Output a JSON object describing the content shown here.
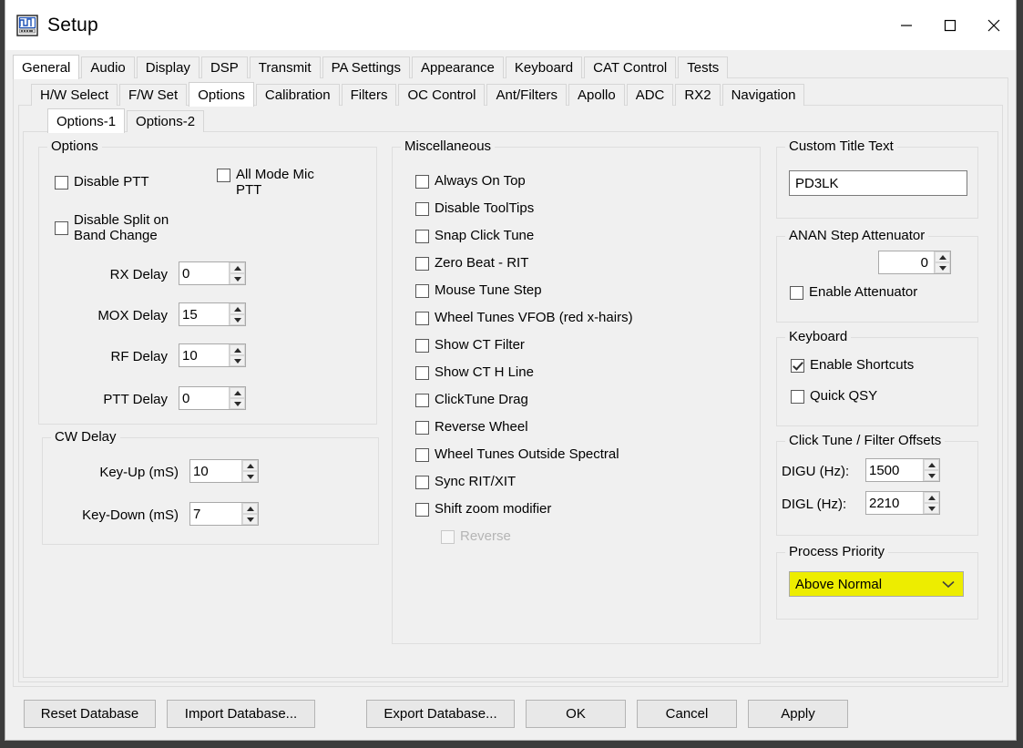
{
  "window": {
    "title": "Setup",
    "icon": "radio-setup-icon",
    "minimize": "minimize-icon",
    "maximize": "maximize-icon",
    "close": "close-icon"
  },
  "tabs_level1": [
    {
      "label": "General",
      "active": true
    },
    {
      "label": "Audio",
      "active": false
    },
    {
      "label": "Display",
      "active": false
    },
    {
      "label": "DSP",
      "active": false
    },
    {
      "label": "Transmit",
      "active": false
    },
    {
      "label": "PA Settings",
      "active": false
    },
    {
      "label": "Appearance",
      "active": false
    },
    {
      "label": "Keyboard",
      "active": false
    },
    {
      "label": "CAT Control",
      "active": false
    },
    {
      "label": "Tests",
      "active": false
    }
  ],
  "tabs_level2": [
    {
      "label": "H/W Select",
      "active": false
    },
    {
      "label": "F/W Set",
      "active": false
    },
    {
      "label": "Options",
      "active": true
    },
    {
      "label": "Calibration",
      "active": false
    },
    {
      "label": "Filters",
      "active": false
    },
    {
      "label": "OC Control",
      "active": false
    },
    {
      "label": "Ant/Filters",
      "active": false
    },
    {
      "label": "Apollo",
      "active": false
    },
    {
      "label": "ADC",
      "active": false
    },
    {
      "label": "RX2",
      "active": false
    },
    {
      "label": "Navigation",
      "active": false
    }
  ],
  "tabs_level3": [
    {
      "label": "Options-1",
      "active": true
    },
    {
      "label": "Options-2",
      "active": false
    }
  ],
  "options_group": {
    "title": "Options",
    "checkboxes": [
      {
        "label": "Disable PTT",
        "checked": false,
        "disabled": false
      },
      {
        "label": "All Mode Mic\nPTT",
        "checked": false,
        "disabled": false
      },
      {
        "label": "Disable Split on\nBand Change",
        "checked": false,
        "disabled": false
      }
    ],
    "spinners": [
      {
        "label": "RX Delay",
        "value": "0"
      },
      {
        "label": "MOX Delay",
        "value": "15"
      },
      {
        "label": "RF Delay",
        "value": "10"
      },
      {
        "label": "PTT Delay",
        "value": "0"
      }
    ]
  },
  "cw_delay_group": {
    "title": "CW Delay",
    "spinners": [
      {
        "label": "Key-Up (mS)",
        "value": "10"
      },
      {
        "label": "Key-Down (mS)",
        "value": "7"
      }
    ]
  },
  "misc_group": {
    "title": "Miscellaneous",
    "checkboxes": [
      {
        "label": "Always On Top",
        "checked": false,
        "disabled": false
      },
      {
        "label": "Disable ToolTips",
        "checked": false,
        "disabled": false
      },
      {
        "label": "Snap Click Tune",
        "checked": false,
        "disabled": false
      },
      {
        "label": "Zero Beat -  RIT",
        "checked": false,
        "disabled": false
      },
      {
        "label": "Mouse Tune Step",
        "checked": false,
        "disabled": false
      },
      {
        "label": "Wheel Tunes VFOB (red x-hairs)",
        "checked": false,
        "disabled": false
      },
      {
        "label": "Show CT Filter",
        "checked": false,
        "disabled": false
      },
      {
        "label": "Show CT H Line",
        "checked": false,
        "disabled": false
      },
      {
        "label": "ClickTune Drag",
        "checked": false,
        "disabled": false
      },
      {
        "label": "Reverse Wheel",
        "checked": false,
        "disabled": false
      },
      {
        "label": "Wheel Tunes Outside Spectral",
        "checked": false,
        "disabled": false
      },
      {
        "label": "Sync RIT/XIT",
        "checked": false,
        "disabled": false
      },
      {
        "label": "Shift zoom modifier",
        "checked": false,
        "disabled": false
      },
      {
        "label": "Reverse",
        "checked": false,
        "disabled": true
      }
    ]
  },
  "custom_title_group": {
    "title": "Custom Title Text",
    "value": "PD3LK",
    "placeholder": ""
  },
  "attenuator_group": {
    "title": "ANAN Step Attenuator",
    "value": "0",
    "checkbox": {
      "label": "Enable Attenuator",
      "checked": false
    }
  },
  "keyboard_group": {
    "title": "Keyboard",
    "checkboxes": [
      {
        "label": "Enable Shortcuts",
        "checked": true
      },
      {
        "label": "Quick QSY",
        "checked": false
      }
    ]
  },
  "offsets_group": {
    "title": "Click Tune / Filter Offsets",
    "rows": [
      {
        "label": "DIGU (Hz):",
        "value": "1500"
      },
      {
        "label": "DIGL (Hz):",
        "value": "2210"
      }
    ]
  },
  "priority_group": {
    "title": "Process Priority",
    "selected": "Above Normal",
    "highlight_color": "#eded00"
  },
  "buttons": [
    {
      "label": "Reset Database",
      "name": "reset-database-button"
    },
    {
      "label": "Import Database...",
      "name": "import-database-button"
    },
    {
      "label": "Export Database...",
      "name": "export-database-button"
    },
    {
      "label": "OK",
      "name": "ok-button"
    },
    {
      "label": "Cancel",
      "name": "cancel-button"
    },
    {
      "label": "Apply",
      "name": "apply-button"
    }
  ]
}
